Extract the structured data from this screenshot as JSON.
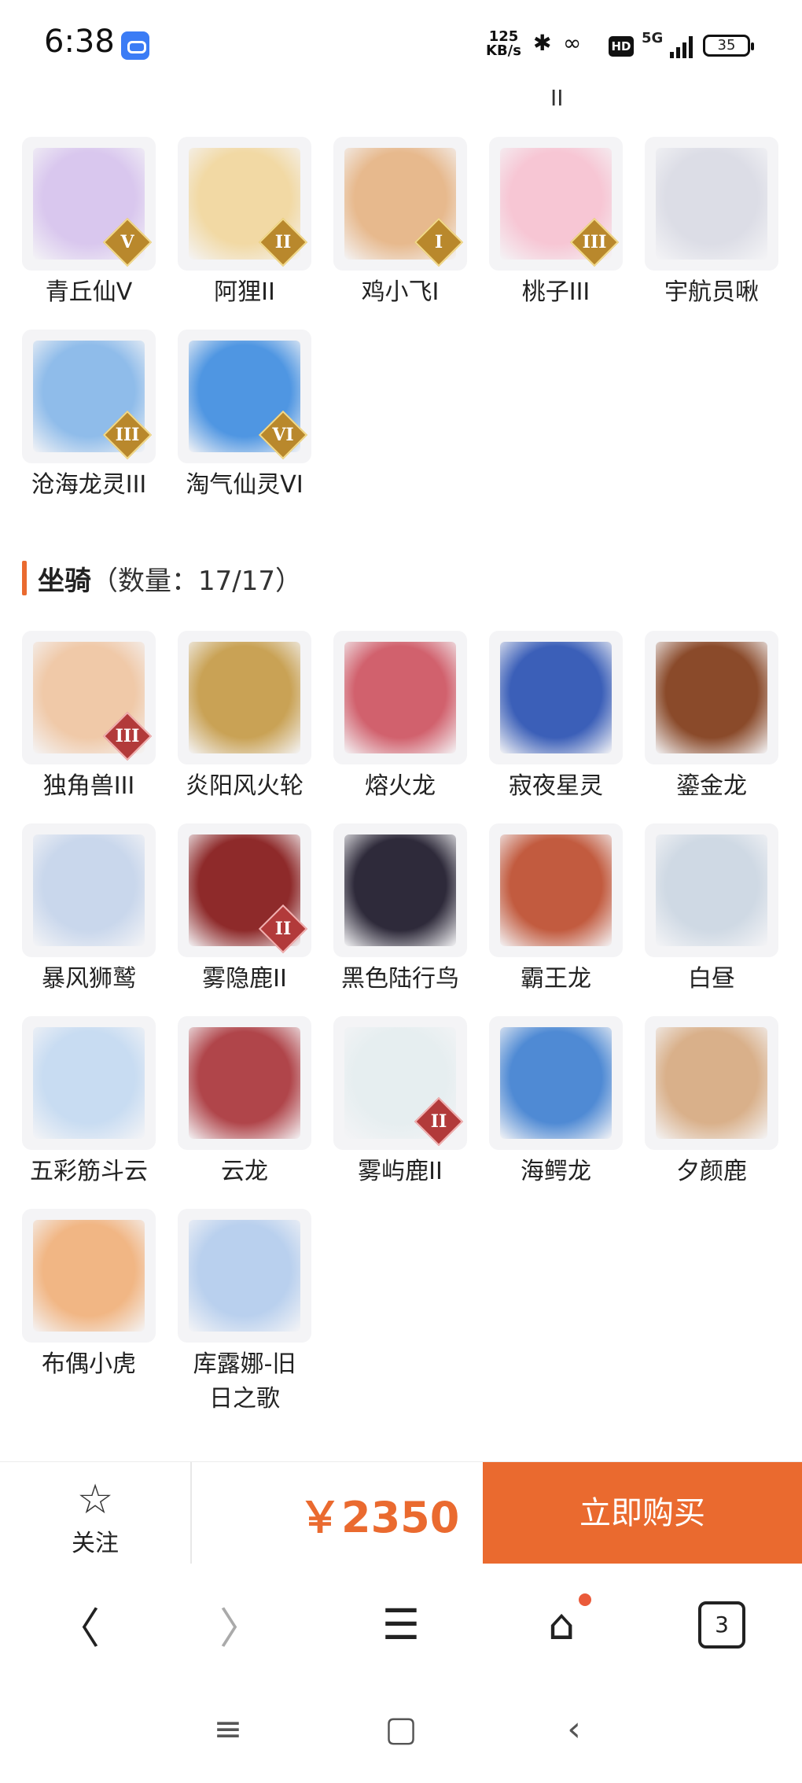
{
  "status_bar": {
    "time": "6:38",
    "net_speed_value": "125",
    "net_speed_unit": "KB/s",
    "hd": "HD",
    "network": "5G",
    "battery": "35"
  },
  "cropped_top_text": "II",
  "pets": [
    {
      "label": "青丘仙V",
      "rank": "V",
      "color": "#d9c7ee"
    },
    {
      "label": "阿狸II",
      "rank": "II",
      "color": "#f2d9a4"
    },
    {
      "label": "鸡小飞I",
      "rank": "I",
      "color": "#e7b98d"
    },
    {
      "label": "桃子III",
      "rank": "III",
      "color": "#f7c6d4"
    },
    {
      "label": "宇航员啾",
      "rank": "",
      "color": "#dcdde6"
    },
    {
      "label": "沧海龙灵III",
      "rank": "III",
      "color": "#8fbcea"
    },
    {
      "label": "淘气仙灵VI",
      "rank": "VI",
      "color": "#4f96e2"
    }
  ],
  "mounts_section": {
    "title": "坐骑",
    "count_text": "（数量：17/17）"
  },
  "mounts": [
    {
      "label": "独角兽III",
      "rank": "III",
      "color": "#f0c9a8"
    },
    {
      "label": "炎阳风火轮",
      "rank": "",
      "color": "#c9a255"
    },
    {
      "label": "熔火龙",
      "rank": "",
      "color": "#d1616d"
    },
    {
      "label": "寂夜星灵",
      "rank": "",
      "color": "#3b5fb8"
    },
    {
      "label": "鎏金龙",
      "rank": "",
      "color": "#8a4a2a"
    },
    {
      "label": "暴风狮鹫",
      "rank": "",
      "color": "#c9d7ec"
    },
    {
      "label": "雾隐鹿II",
      "rank": "II",
      "color": "#8e2a2a"
    },
    {
      "label": "黑色陆行鸟",
      "rank": "",
      "color": "#2e2a3a"
    },
    {
      "label": "霸王龙",
      "rank": "",
      "color": "#c25b3f"
    },
    {
      "label": "白昼",
      "rank": "",
      "color": "#cfd9e4"
    },
    {
      "label": "五彩筋斗云",
      "rank": "",
      "color": "#c8dcf2"
    },
    {
      "label": "云龙",
      "rank": "",
      "color": "#b0454a"
    },
    {
      "label": "雾屿鹿II",
      "rank": "II",
      "color": "#e6eef0"
    },
    {
      "label": "海鳄龙",
      "rank": "",
      "color": "#4f8ad4"
    },
    {
      "label": "夕颜鹿",
      "rank": "",
      "color": "#d9b08a"
    },
    {
      "label": "布偶小虎",
      "rank": "",
      "color": "#f1b684"
    },
    {
      "label": "库露娜-旧\n日之歌",
      "rank": "",
      "color": "#b9d0ee"
    }
  ],
  "action_bar": {
    "follow_label": "关注",
    "follow_icon": "star-outline-icon",
    "price": "￥2350",
    "buy_label": "立即购买",
    "accent": "#ea6a2f"
  },
  "browser_nav": {
    "back_icon": "chevron-left-icon",
    "forward_icon": "chevron-right-icon",
    "menu_icon": "hamburger-menu-icon",
    "home_icon": "home-icon",
    "tab_count": "3"
  }
}
